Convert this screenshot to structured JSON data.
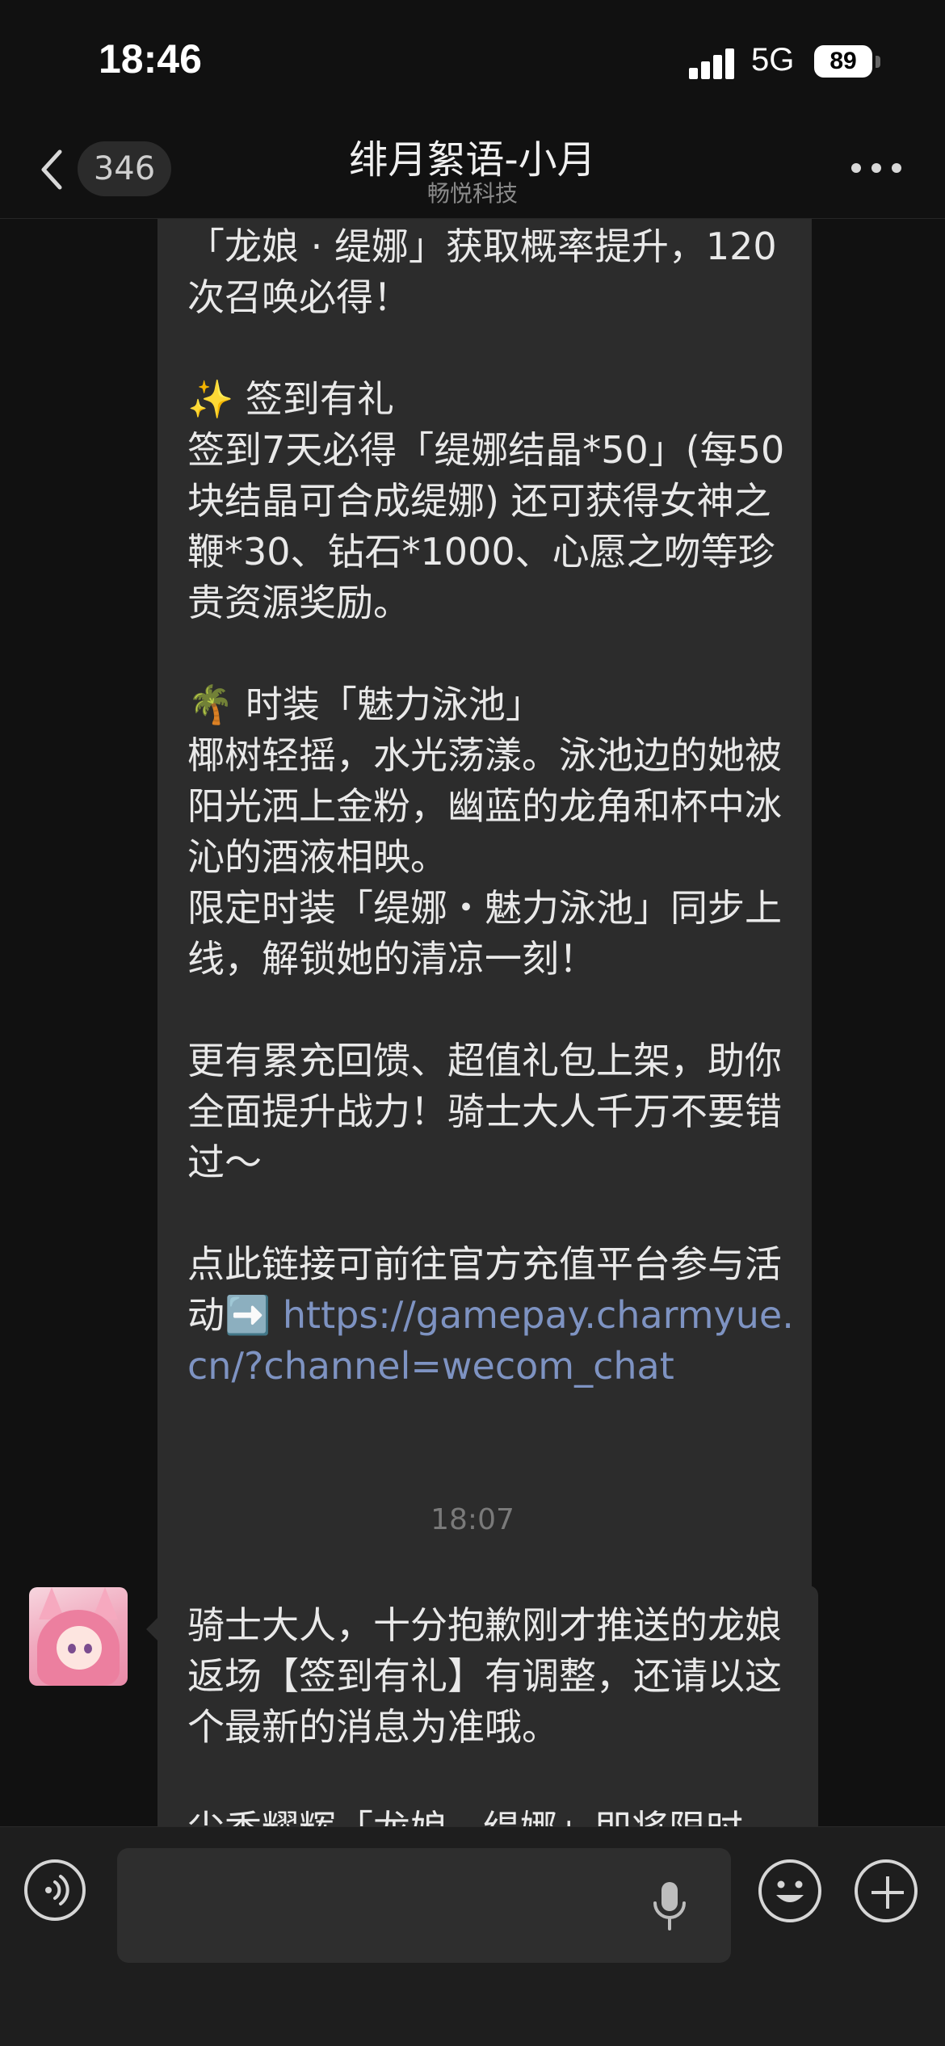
{
  "status_bar": {
    "time": "18:46",
    "network": "5G",
    "battery": "89"
  },
  "nav": {
    "back_count": "346",
    "title": "绯月絮语-小月",
    "subtitle": "畅悦科技"
  },
  "messages": {
    "first_text": "✨ 仙灵召唤\n「龙娘 · 缇娜」获取概率提升，120次召唤必得！\n\n✨ 签到有礼\n签到7天必得「缇娜结晶*50」(每50块结晶可合成缇娜) 还可获得女神之鞭*30、钻石*1000、心愿之吻等珍贵资源奖励。\n\n🌴 时装「魅力泳池」\n椰树轻摇，水光荡漾。泳池边的她被阳光洒上金粉，幽蓝的龙角和杯中冰沁的酒液相映。\n限定时装「缇娜・魅力泳池」同步上线，解锁她的清凉一刻！\n\n更有累充回馈、超值礼包上架，助你全面提升战力！骑士大人千万不要错过～\n\n点此链接可前往官方充值平台参与活动➡️ ",
    "first_link": "https://gamepay.charmyue.cn/?channel=wecom_chat",
    "timestamp": "18:07",
    "second_text": "骑士大人，十分抱歉刚才推送的龙娘返场【签到有礼】有调整，还请以这个最新的消息为准哦。\n\n尘香耀辉「龙娘 · 缇娜」即将限时"
  },
  "colors": {
    "background": "#111111",
    "bubble": "#2c2c2c",
    "link": "#7e93c2"
  },
  "icons": [
    "back-chevron-icon",
    "more-dots-icon",
    "voice-icon",
    "microphone-icon",
    "emoji-icon",
    "plus-icon"
  ]
}
